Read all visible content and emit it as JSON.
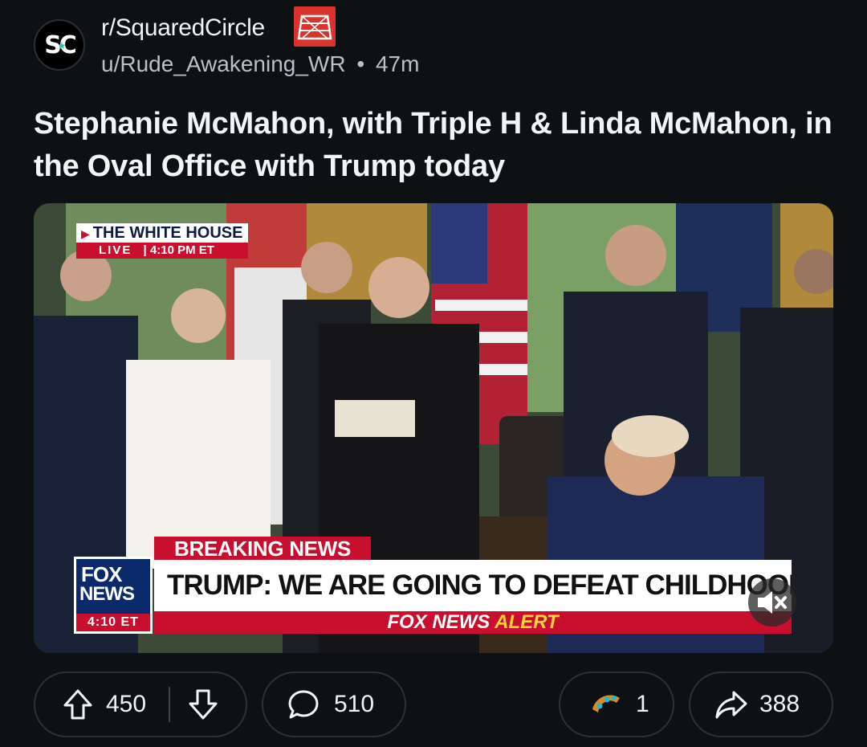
{
  "post": {
    "subreddit": "r/SquaredCircle",
    "avatar_text": "SC",
    "author": "u/Rude_Awakening_WR",
    "separator": "•",
    "age": "47m",
    "title": "Stephanie McMahon, with Triple H & Linda McMahon, in the Oval Office with Trump today"
  },
  "media": {
    "overlay": {
      "network_bug_title": "THE WHITE HOUSE",
      "live_label": "LIVE",
      "live_sep": "|",
      "live_time": "4:10 PM ET",
      "breaking_label": "BREAKING NEWS",
      "headline": "TRUMP: WE ARE GOING TO DEFEAT CHILDHOOD CANCER",
      "alert_brand": "FOX NEWS",
      "alert_word": "ALERT",
      "logo_line1": "FOX",
      "logo_line2": "NEWS",
      "logo_time": "4:10 ET"
    },
    "muted_icon": "speaker-muted-icon"
  },
  "actions": {
    "score": "450",
    "comments": "510",
    "awards": "1",
    "shares": "388"
  },
  "colors": {
    "background": "#0e1113",
    "fox_red": "#c8102e",
    "fox_blue": "#0b2a6b",
    "alert_yellow": "#ffd43b"
  }
}
